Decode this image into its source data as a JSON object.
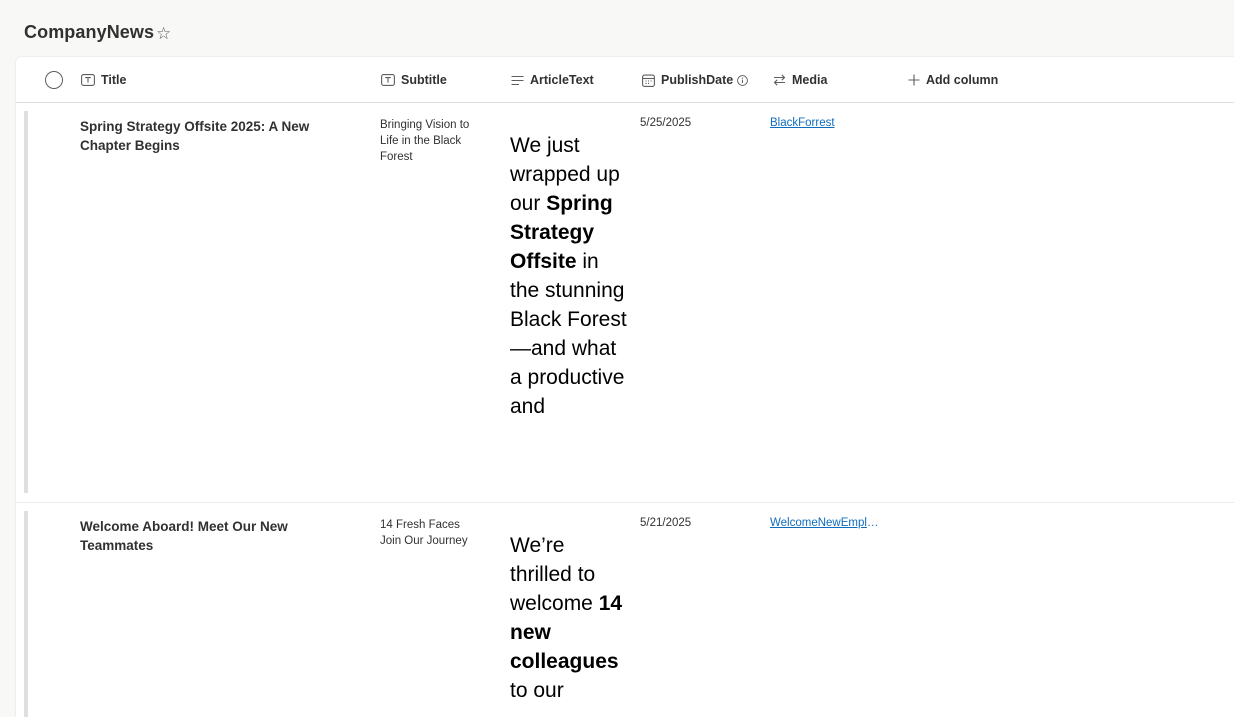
{
  "list": {
    "title": "CompanyNews",
    "favorite_icon": "star-outline-icon"
  },
  "columns": [
    {
      "label": "Title",
      "icon": "text-field-icon"
    },
    {
      "label": "Subtitle",
      "icon": "text-field-icon"
    },
    {
      "label": "ArticleText",
      "icon": "multiline-text-icon"
    },
    {
      "label": "PublishDate",
      "icon": "calendar-icon",
      "info_icon": "info-icon"
    },
    {
      "label": "Media",
      "icon": "lookup-arrows-icon"
    },
    {
      "label": "Add column",
      "icon": "plus-icon"
    }
  ],
  "rows": [
    {
      "title": "Spring Strategy Offsite 2025: A New Chapter Begins",
      "subtitle": "Bringing Vision to Life in the Black Forest",
      "article": {
        "p1": "We just wrapped up our ",
        "b1": "Spring Strategy Offsite",
        "p2": " in the stunning Black Forest—and what a productive and"
      },
      "publish_date": "5/25/2025",
      "media": "BlackForrest"
    },
    {
      "title": "Welcome Aboard! Meet Our New Teammates",
      "subtitle": "14 Fresh Faces Join Our Journey",
      "article": {
        "p1": "We’re thrilled to welcome ",
        "b1": "14 new colleagues",
        "p2": " to our"
      },
      "publish_date": "5/21/2025",
      "media": "WelcomeNewEmployees"
    }
  ]
}
